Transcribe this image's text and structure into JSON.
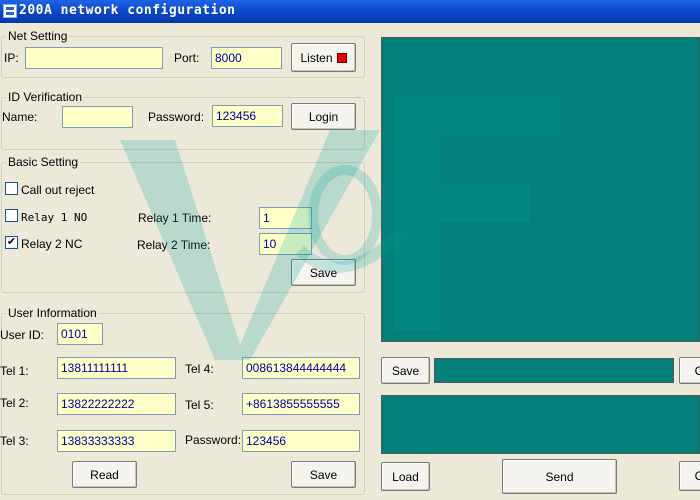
{
  "window": {
    "title": "200A network configuration",
    "icon": "app-grid-icon"
  },
  "net_setting": {
    "title": "Net Setting",
    "ip_label": "IP:",
    "ip_value": "",
    "port_label": "Port:",
    "port_value": "8000",
    "listen_label": "Listen",
    "listen_indicator_color": "#ee0000"
  },
  "id_verification": {
    "title": "ID Verification",
    "name_label": "Name:",
    "name_value": "",
    "password_label": "Password:",
    "password_value": "123456",
    "login_label": "Login"
  },
  "basic_setting": {
    "title": "Basic Setting",
    "call_out_reject": {
      "label": "Call out reject",
      "checked": false
    },
    "relay1_no": {
      "label": "Relay 1 NO",
      "checked": false
    },
    "relay2_nc": {
      "label": "Relay 2 NC",
      "checked": true
    },
    "relay1_time_label": "Relay 1 Time:",
    "relay1_time_value": "1",
    "relay2_time_label": "Relay 2 Time:",
    "relay2_time_value": "10",
    "save_label": "Save"
  },
  "user_information": {
    "title": "User Information",
    "user_id_label": "User ID:",
    "user_id_value": "0101",
    "tel1_label": "Tel 1:",
    "tel1_value": "13811111111",
    "tel2_label": "Tel 2:",
    "tel2_value": "13822222222",
    "tel3_label": "Tel 3:",
    "tel3_value": "13833333333",
    "tel4_label": "Tel 4:",
    "tel4_value": "008613844444444",
    "tel5_label": "Tel 5:",
    "tel5_value": "+8613855555555",
    "password_label": "Password:",
    "password_value": "123456",
    "read_label": "Read",
    "save_label": "Save"
  },
  "right_panel": {
    "save_label": "Save",
    "save_path_value": "",
    "clear_top_label": "C",
    "load_label": "Load",
    "send_label": "Send",
    "clear_bottom_label": "C",
    "display_color": "#03807a"
  },
  "checkmark_glyph": "✔"
}
